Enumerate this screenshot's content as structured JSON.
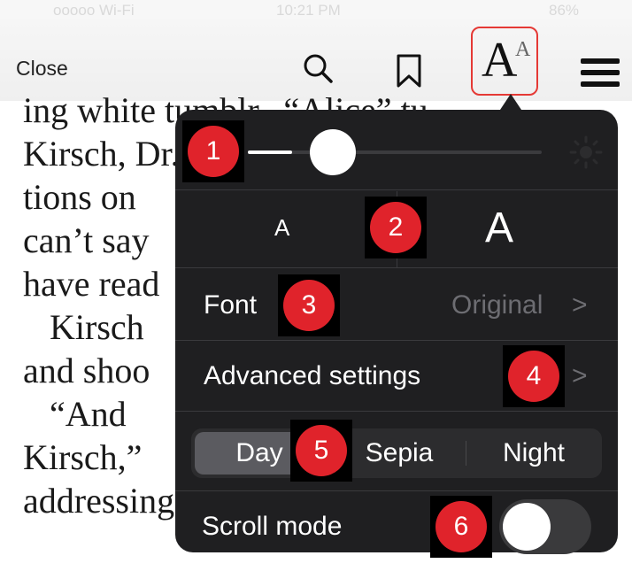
{
  "status_bar": {
    "carrier": "ooooo Wi-Fi",
    "time": "10:21 PM",
    "battery": "86%"
  },
  "toolbar": {
    "close_label": "Close",
    "font_button_large": "A",
    "font_button_small": "A"
  },
  "book_text": {
    "lines": [
      "ing white tumblr.  “Alice” tu",
      "Kirsch, Dr.",
      "tions on ",
      "can’t say",
      "have read",
      "   Kirsch",
      "and shoo",
      "   “And ",
      "Kirsch,” ",
      "addressing his two colleagues,"
    ]
  },
  "settings_panel": {
    "brightness": {
      "level": 0.15
    },
    "font_size": {
      "smaller_label": "A",
      "larger_label": "A"
    },
    "font_row": {
      "label": "Font",
      "value": "Original",
      "chevron": ">"
    },
    "advanced_row": {
      "label": "Advanced settings",
      "chevron": ">"
    },
    "themes": {
      "options": [
        "Day",
        "Sepia",
        "Night"
      ],
      "selected": "Day"
    },
    "scroll_mode": {
      "label": "Scroll mode",
      "enabled": false
    }
  },
  "annotations": [
    "1",
    "2",
    "3",
    "4",
    "5",
    "6"
  ],
  "colors": {
    "panel_bg": "#1f1f21",
    "badge_red": "#e0232b",
    "highlight_border": "#e53935",
    "muted_text": "#6d6d72"
  }
}
